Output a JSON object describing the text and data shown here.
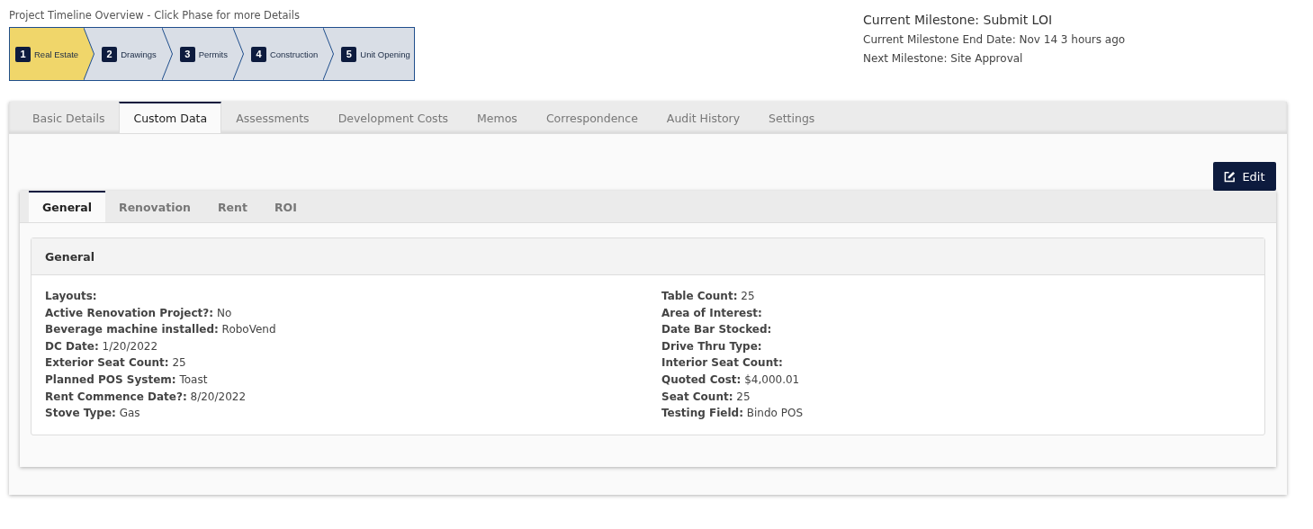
{
  "timeline": {
    "title": "Project Timeline Overview - Click Phase for more Details",
    "phases": [
      {
        "number": "1",
        "label": "Real Estate",
        "selected": true
      },
      {
        "number": "2",
        "label": "Drawings",
        "selected": false
      },
      {
        "number": "3",
        "label": "Permits",
        "selected": false
      },
      {
        "number": "4",
        "label": "Construction",
        "selected": false
      },
      {
        "number": "5",
        "label": "Unit Opening",
        "selected": false
      }
    ]
  },
  "milestone": {
    "current": "Current Milestone: Submit LOI",
    "end_date": "Current Milestone End Date: Nov 14 3 hours ago",
    "next": "Next Milestone: Site Approval"
  },
  "tabs": [
    {
      "label": "Basic Details",
      "selected": false
    },
    {
      "label": "Custom Data",
      "selected": true
    },
    {
      "label": "Assessments",
      "selected": false
    },
    {
      "label": "Development Costs",
      "selected": false
    },
    {
      "label": "Memos",
      "selected": false
    },
    {
      "label": "Correspondence",
      "selected": false
    },
    {
      "label": "Audit History",
      "selected": false
    },
    {
      "label": "Settings",
      "selected": false
    }
  ],
  "edit_button": "Edit",
  "subtabs": [
    {
      "label": "General",
      "selected": true
    },
    {
      "label": "Renovation",
      "selected": false
    },
    {
      "label": "Rent",
      "selected": false
    },
    {
      "label": "ROI",
      "selected": false
    }
  ],
  "card": {
    "title": "General",
    "left_fields": [
      {
        "label": "Layouts:"
      },
      {
        "label": "Active Renovation Project?:",
        "value": "No"
      },
      {
        "label": "Beverage machine installed:",
        "value": "RoboVend"
      },
      {
        "label": "DC Date:",
        "value": "1/20/2022"
      },
      {
        "label": "Exterior Seat Count:",
        "value": "25"
      },
      {
        "label": "Planned POS System:",
        "value": "Toast"
      },
      {
        "label": "Rent Commence Date?:",
        "value": "8/20/2022"
      },
      {
        "label": "Stove Type:",
        "value": "Gas"
      }
    ],
    "right_fields": [
      {
        "label": "Table Count:",
        "value": "25"
      },
      {
        "label": "Area of Interest:"
      },
      {
        "label": "Date Bar Stocked:"
      },
      {
        "label": "Drive Thru Type:"
      },
      {
        "label": "Interior Seat Count:"
      },
      {
        "label": "Quoted Cost:",
        "value": "$4,000.01"
      },
      {
        "label": "Seat Count:",
        "value": "25"
      },
      {
        "label": "Testing Field:",
        "value": "Bindo POS"
      }
    ]
  }
}
